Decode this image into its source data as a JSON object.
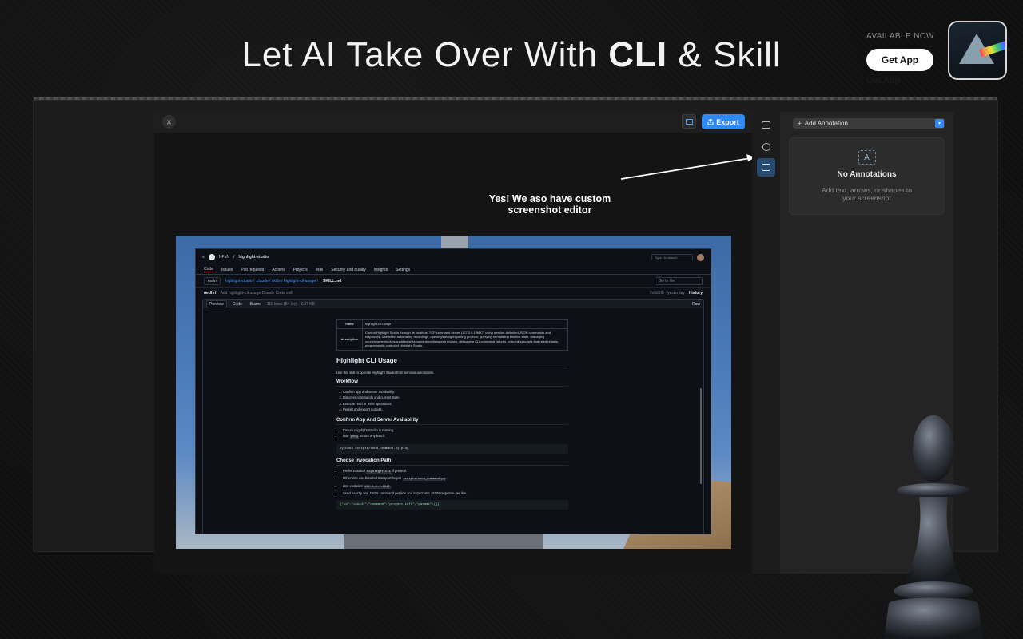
{
  "hero": {
    "title_prefix": "Let AI Take Over With ",
    "title_bold": "CLI",
    "title_suffix": " & Skill"
  },
  "promo": {
    "available": "AVAILABLE NOW",
    "button": "Get App",
    "ghost": "Get App"
  },
  "editor": {
    "close_icon": "×",
    "export_label": "Export",
    "callout": "Yes! We aso have custom screenshot editor",
    "panel": {
      "add_label": "Add Annotation",
      "empty_title": "No Annotations",
      "empty_sub": "Add text, arrows, or shapes to your screenshot",
      "placeholder_glyph": "A"
    }
  },
  "github": {
    "org": "NFuN",
    "repo": "highlight-studio",
    "nav": [
      "Code",
      "Issues",
      "Pull requests",
      "Actions",
      "Projects",
      "Wiki",
      "Security and quality",
      "Insights",
      "Settings"
    ],
    "search": "Type / to search",
    "branch": "main",
    "path": "highlight-studio / .claude / skills / highlight-cli-usage /",
    "file": "SKILL.md",
    "go_to_file": "Go to file",
    "commit_author": "nedhrf",
    "commit_msg": "Add highlight-cli-usage Claude Code skill",
    "commit_meta": "7e8d1f0 · yesterday",
    "history": "History",
    "tabs": [
      "Preview",
      "Code",
      "Blame"
    ],
    "file_meta": "116 lines (84 loc) · 3.27 KB",
    "raw": "Raw",
    "doc": {
      "rows": [
        {
          "k": "name",
          "v": "highlight-cli-usage"
        },
        {
          "k": "description",
          "v": "Control Highlight Studio through its localhost TCP command server (127.0.0.1:9847) using newline-delimited JSON commands and responses. Use when automating recordings, opening/saving/exporting projects, querying or mutating timeline state, managing zoom/segments/clips/subtitles/style/camera/media/speed regions, debugging CLI command failures, or building scripts that need reliable programmatic control of Highlight Studio."
        }
      ],
      "h1": "Highlight CLI Usage",
      "intro": "Use this skill to operate Highlight Studio from terminal automation.",
      "h_workflow": "Workflow",
      "workflow": [
        "Confirm app and server availability.",
        "Discover commands and current state.",
        "Execute read or write operations.",
        "Persist and export outputs."
      ],
      "h_confirm": "Confirm App And Server Availability",
      "confirm_1": "Ensure Highlight Studio is running.",
      "confirm_2a": "Use ",
      "confirm_2code": "ping",
      "confirm_2b": " before any batch.",
      "code_1": "python3 scripts/send_command.py ping",
      "h_invoke": "Choose Invocation Path",
      "inv_1a": "Prefer installed ",
      "inv_1code": "highlight-cli",
      "inv_1b": " if present.",
      "inv_2a": "Otherwise use bundled transport helper ",
      "inv_2code": "scripts/send_command.py",
      "inv_2b": ".",
      "inv_3a": "Use endpoint ",
      "inv_3code": "127.0.0.1:9847",
      "inv_3b": ".",
      "inv_4": "Send exactly one JSON command per line and expect one JSON response per line.",
      "code_2": "{\"id\":\"<uuid>\",\"command\":\"project.info\",\"params\":{}}"
    }
  }
}
